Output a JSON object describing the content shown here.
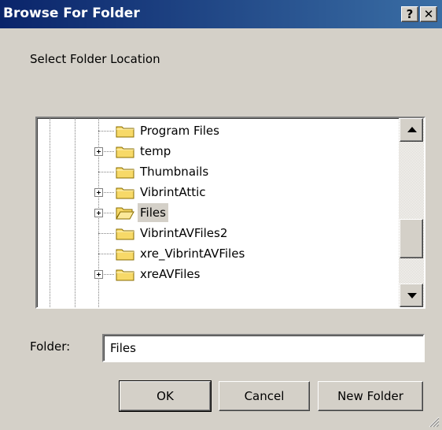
{
  "window": {
    "title": "Browse For Folder",
    "help_button": "?",
    "close_button": "✕"
  },
  "prompt": "Select Folder Location",
  "tree": {
    "items": [
      {
        "label": "Program Files",
        "expandable": false,
        "selected": false,
        "open": false
      },
      {
        "label": "temp",
        "expandable": true,
        "selected": false,
        "open": false
      },
      {
        "label": "Thumbnails",
        "expandable": false,
        "selected": false,
        "open": false
      },
      {
        "label": "VibrintAttic",
        "expandable": true,
        "selected": false,
        "open": false
      },
      {
        "label": "Files",
        "expandable": true,
        "selected": true,
        "open": true
      },
      {
        "label": "VibrintAVFiles2",
        "expandable": false,
        "selected": false,
        "open": false
      },
      {
        "label": "xre_VibrintAVFiles",
        "expandable": false,
        "selected": false,
        "open": false
      },
      {
        "label": "xreAVFiles",
        "expandable": true,
        "selected": false,
        "open": false
      }
    ]
  },
  "folder_field": {
    "label": "Folder:",
    "value": "Files"
  },
  "buttons": {
    "ok": "OK",
    "cancel": "Cancel",
    "new_folder": "New Folder"
  },
  "colors": {
    "title_gradient_start": "#0a246a",
    "title_gradient_end": "#3a6ea5",
    "dialog_face": "#d4d0c8",
    "folder_yellow": "#f7d968"
  }
}
